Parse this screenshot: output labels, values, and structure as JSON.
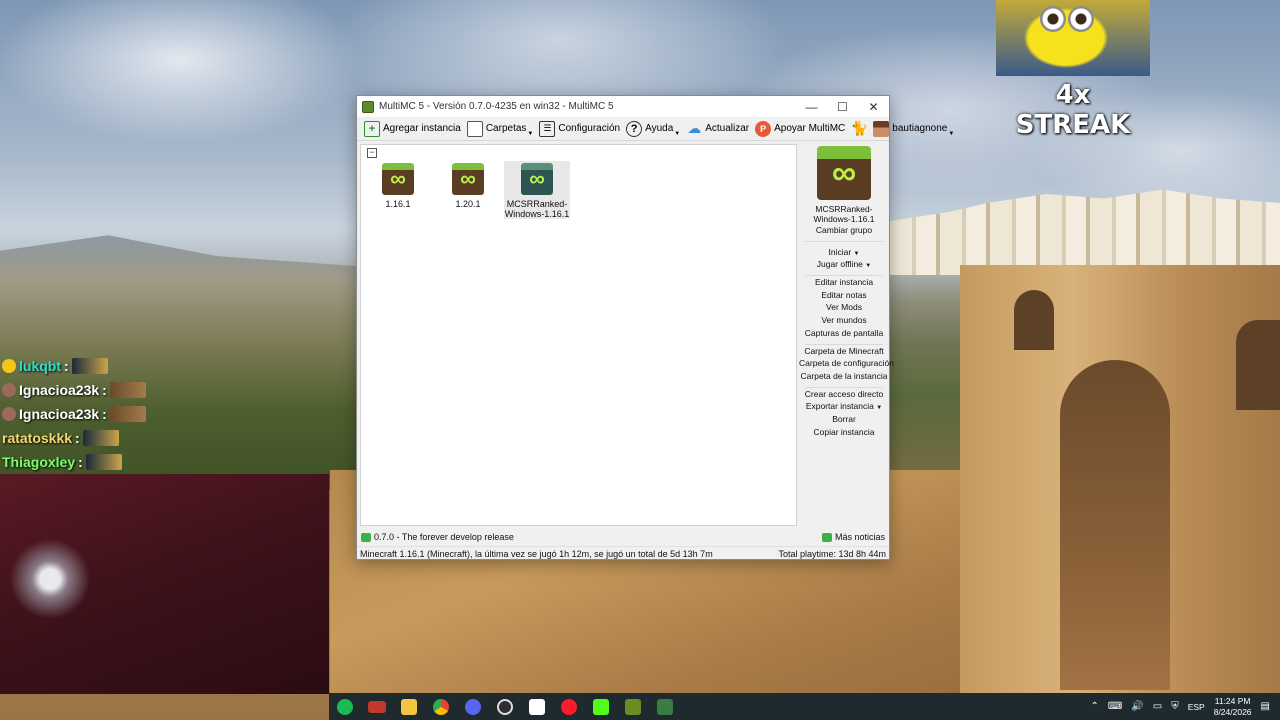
{
  "overlay": {
    "streak_text": "4x STREAK",
    "chat": [
      {
        "name": "lukqbt",
        "color": "#2fe0c8",
        "badge": "#f5c518"
      },
      {
        "name": "Ignacioa23k",
        "color": "#ffffff",
        "badge": "#9b6a5a"
      },
      {
        "name": "Ignacioa23k",
        "color": "#ffffff",
        "badge": "#9b6a5a"
      },
      {
        "name": "ratatoskkk",
        "color": "#f5d76e",
        "badge": ""
      },
      {
        "name": "Thiagoxley",
        "color": "#7cfc6c",
        "badge": ""
      }
    ],
    "chat_colon": ":"
  },
  "window": {
    "title": "MultiMC 5 - Versión 0.7.0-4235 en win32 - MultiMC 5",
    "controls": {
      "minimize": "—",
      "maximize": "☐",
      "close": "✕"
    }
  },
  "toolbar": {
    "add_instance": "Agregar instancia",
    "folders": "Carpetas",
    "settings": "Configuración",
    "help": "Ayuda",
    "update": "Actualizar",
    "support": "Apoyar MultiMC",
    "account": "bautiagnone"
  },
  "instances": [
    {
      "name": "1.16.1"
    },
    {
      "name": "1.20.1"
    },
    {
      "name": "MCSRRanked-Windows-1.16.1"
    }
  ],
  "side_panel": {
    "instance_name": "MCSRRanked-Windows-1.16.1",
    "change_group": "Cambiar grupo",
    "launch": "Iniciar",
    "launch_offline": "Jugar offline",
    "edit_instance": "Editar instancia",
    "edit_notes": "Editar notas",
    "view_mods": "Ver Mods",
    "view_worlds": "Ver mundos",
    "screenshots": "Capturas de pantalla",
    "minecraft_folder": "Carpeta de Minecraft",
    "config_folder": "Carpeta de configuración",
    "instance_folder": "Carpeta de la instancia",
    "create_shortcut": "Crear acceso directo",
    "export_instance": "Exportar instancia",
    "delete": "Borrar",
    "copy_instance": "Copiar instancia",
    "dropdown_arrow": "▼"
  },
  "status": {
    "news": "0.7.0 - The forever develop release",
    "more_news": "Más noticias",
    "last_played": "Minecraft 1.16.1 (Minecraft), la última vez se jugó 1h 12m, se jugó un total de 5d 13h 7m",
    "total_playtime": "Total playtime: 13d 8h 44m"
  },
  "taskbar": {
    "apps": [
      {
        "icon": "spotify-icon",
        "color": "#1db954"
      },
      {
        "icon": "voicemeeter-icon",
        "color": "#c0392b"
      },
      {
        "icon": "file-explorer-icon",
        "color": "#f4c542"
      },
      {
        "icon": "chrome-icon",
        "color": "#4285f4"
      },
      {
        "icon": "discord-icon",
        "color": "#5865f2"
      },
      {
        "icon": "obs-icon",
        "color": "#302e31"
      },
      {
        "icon": "tiktok-live-icon",
        "color": "#ffffff"
      },
      {
        "icon": "opera-icon",
        "color": "#ff1b2d"
      },
      {
        "icon": "kick-icon",
        "color": "#53fc18"
      },
      {
        "icon": "multimc-icon",
        "color": "#6b8e23"
      },
      {
        "icon": "minecraft-launcher-icon",
        "color": "#3a7d44"
      }
    ],
    "language": "ESP",
    "time": "11:24 PM",
    "date": "8/24/2026"
  }
}
